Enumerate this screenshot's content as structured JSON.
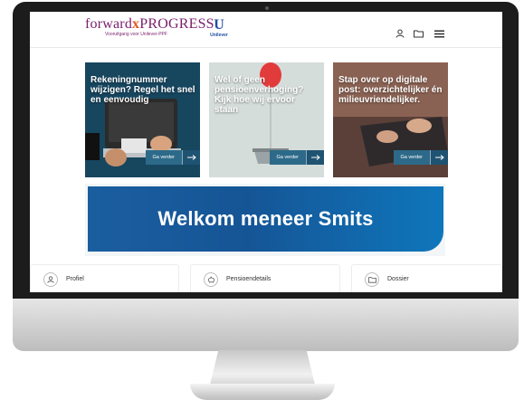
{
  "header": {
    "logo": {
      "brand_part1": "forward",
      "brand_x": "x",
      "brand_part2": "PROGRESS",
      "tagline": "Vooruitgang voor Unilever-PPF"
    },
    "partner_logo": {
      "mark": "U",
      "name": "Unilever"
    },
    "icons": [
      "user-icon",
      "folder-icon",
      "hamburger-menu-icon"
    ]
  },
  "tiles": [
    {
      "title": "Rekeningnummer wijzigen? Regel het snel en eenvoudig",
      "button_label": "Ga verder",
      "bg": "#1c4e6e"
    },
    {
      "title": "Wel of geen pensioenverhoging? Kijk hoe wij ervoor staan",
      "button_label": "Ga verder",
      "bg": "#cfd8d6"
    },
    {
      "title": "Stap over op digitale post: overzichtelijker én milieuvriendelijker.",
      "button_label": "Ga verder",
      "bg": "#7b5a4e"
    }
  ],
  "banner": {
    "text": "Welkom meneer Smits"
  },
  "cards": [
    {
      "label": "Profiel",
      "icon": "user-icon"
    },
    {
      "label": "Pensioendetails",
      "icon": "piggy-bank-icon"
    },
    {
      "label": "Dossier",
      "icon": "folder-icon"
    }
  ],
  "colors": {
    "brand_purple": "#7a1f6c",
    "brand_orange": "#e25b22",
    "unilever_blue": "#1f4fa0",
    "banner_blue": "#155596",
    "button_blue": "#2d6a89"
  }
}
